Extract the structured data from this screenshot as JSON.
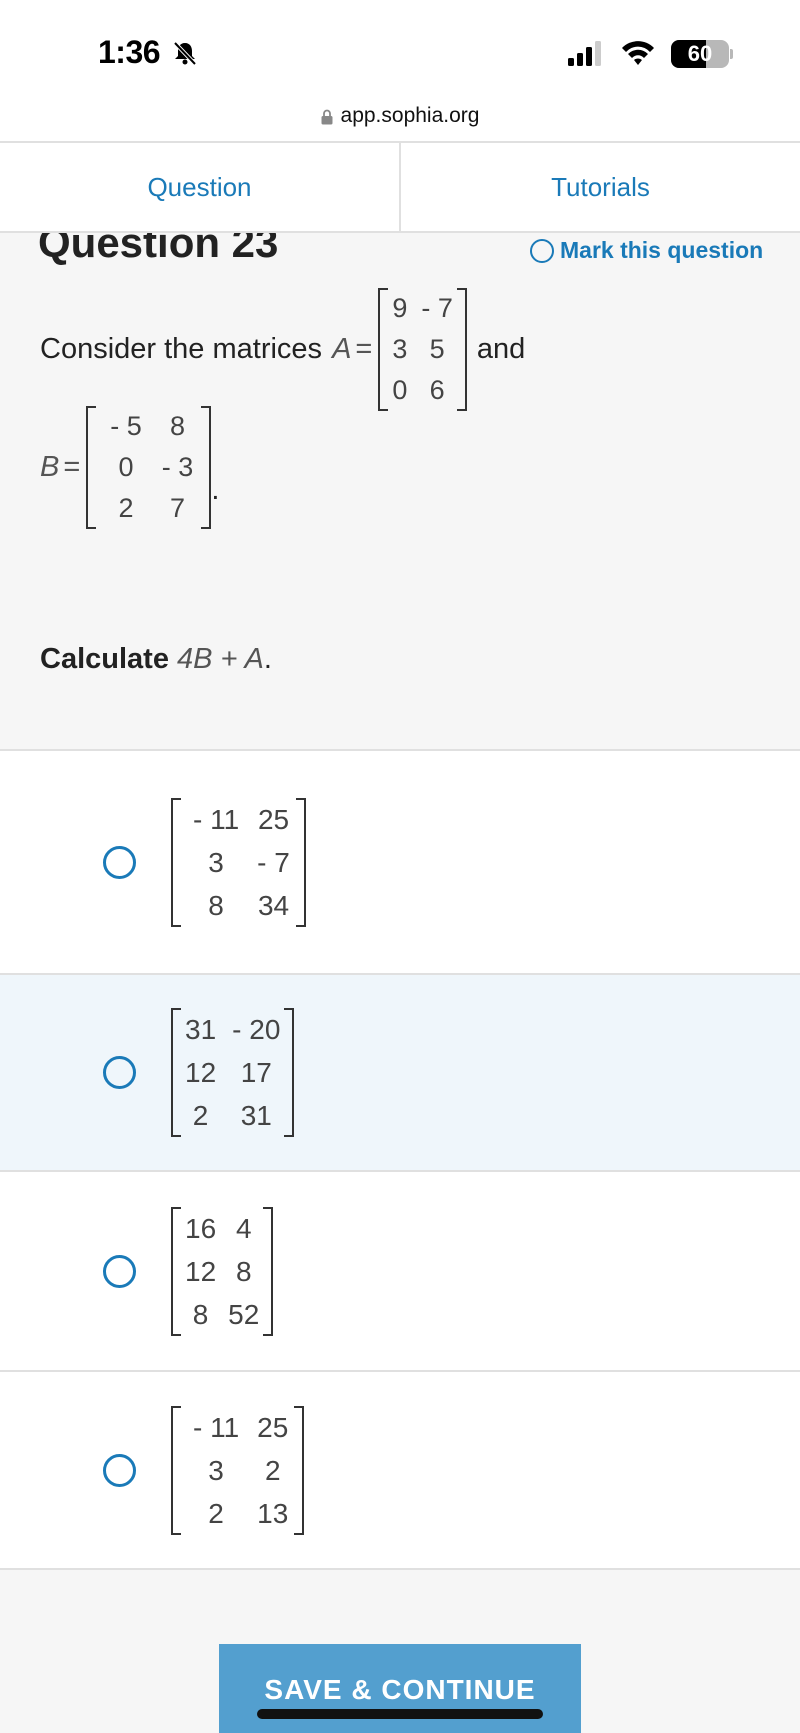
{
  "status_bar": {
    "time": "1:36",
    "battery_level": "60",
    "battery_fraction": 0.6,
    "icons": [
      "bell-slash-icon",
      "signal-icon",
      "wifi-icon",
      "battery-icon"
    ]
  },
  "browser": {
    "url": "app.sophia.org"
  },
  "tabs": [
    {
      "label": "Question"
    },
    {
      "label": "Tutorials"
    }
  ],
  "question": {
    "title": "Question 23",
    "mark_label": "Mark this question",
    "prompt_prefix": "Consider the matrices",
    "matrix_a_name": "A",
    "matrix_a": [
      [
        "9",
        "- 7"
      ],
      [
        "3",
        "5"
      ],
      [
        "0",
        "6"
      ]
    ],
    "conjunction": "and",
    "matrix_b_name": "B",
    "matrix_b": [
      [
        "- 5",
        "8"
      ],
      [
        "0",
        "- 3"
      ],
      [
        "2",
        "7"
      ]
    ],
    "period": ".",
    "equals": "=",
    "calc_label": "Calculate",
    "calc_expr": "4B + A",
    "calc_end": "."
  },
  "answers": [
    {
      "matrix": [
        [
          "- 11",
          "25"
        ],
        [
          "3",
          "- 7"
        ],
        [
          "8",
          "34"
        ]
      ]
    },
    {
      "matrix": [
        [
          "31",
          "- 20"
        ],
        [
          "12",
          "17"
        ],
        [
          "2",
          "31"
        ]
      ]
    },
    {
      "matrix": [
        [
          "16",
          "4"
        ],
        [
          "12",
          "8"
        ],
        [
          "8",
          "52"
        ]
      ]
    },
    {
      "matrix": [
        [
          "- 11",
          "25"
        ],
        [
          "3",
          "2"
        ],
        [
          "2",
          "13"
        ]
      ]
    }
  ],
  "footer": {
    "save_label": "SAVE & CONTINUE"
  },
  "colors": {
    "accent": "#1a7ab8",
    "button": "#539fcf",
    "hover_row": "#eff6fb",
    "background": "#f6f6f6"
  }
}
